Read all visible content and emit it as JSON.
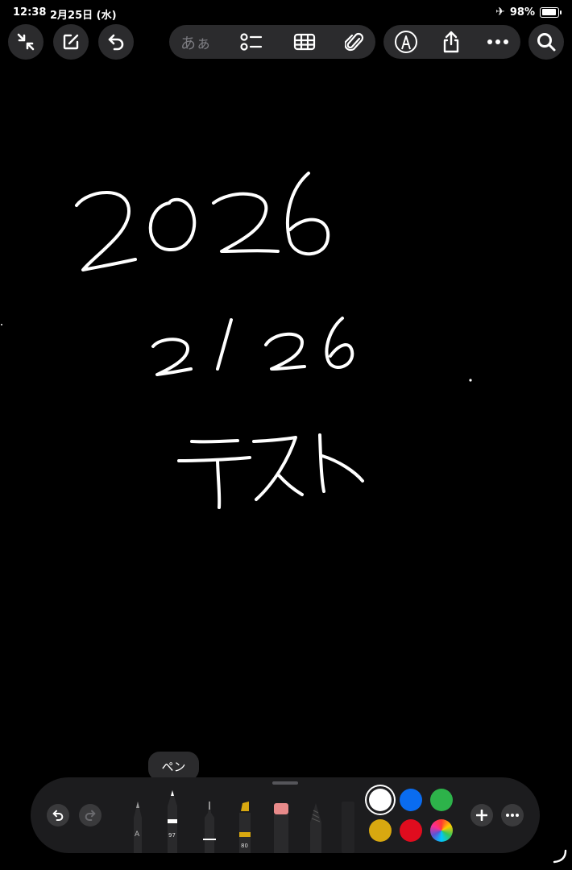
{
  "status_bar": {
    "time": "12:38",
    "date": "2月25日 (水)",
    "battery": "98%",
    "airplane_icon": "airplane-icon"
  },
  "top_toolbar": {
    "left_buttons": [
      "collapse-icon",
      "compose-icon",
      "undo-icon"
    ],
    "format_pill": {
      "text_format_label": "あぁ",
      "icons": [
        "checklist-icon",
        "table-icon",
        "attachment-icon"
      ]
    },
    "right_pill": {
      "icons": [
        "markup-pen-icon",
        "share-icon",
        "more-icon"
      ]
    },
    "search_icon": "search-icon"
  },
  "note_content": {
    "handwritten_lines": [
      "2026",
      "2/26",
      "テスト"
    ]
  },
  "tool_palette": {
    "tooltip": "ペン",
    "tools": [
      {
        "name": "pencil",
        "label": "A"
      },
      {
        "name": "pen",
        "label": "97"
      },
      {
        "name": "fineliner",
        "label": ""
      },
      {
        "name": "marker",
        "label": "80"
      },
      {
        "name": "eraser",
        "label": ""
      },
      {
        "name": "crayon",
        "label": ""
      },
      {
        "name": "ruler",
        "label": ""
      }
    ],
    "colors": [
      "#ffffff",
      "#0a6cf0",
      "#2db34a",
      "#d8a810",
      "#e00c1e",
      "color-wheel"
    ],
    "selected_color": "#ffffff",
    "buttons": [
      "undo-icon",
      "redo-icon",
      "add-icon",
      "more-icon"
    ]
  }
}
